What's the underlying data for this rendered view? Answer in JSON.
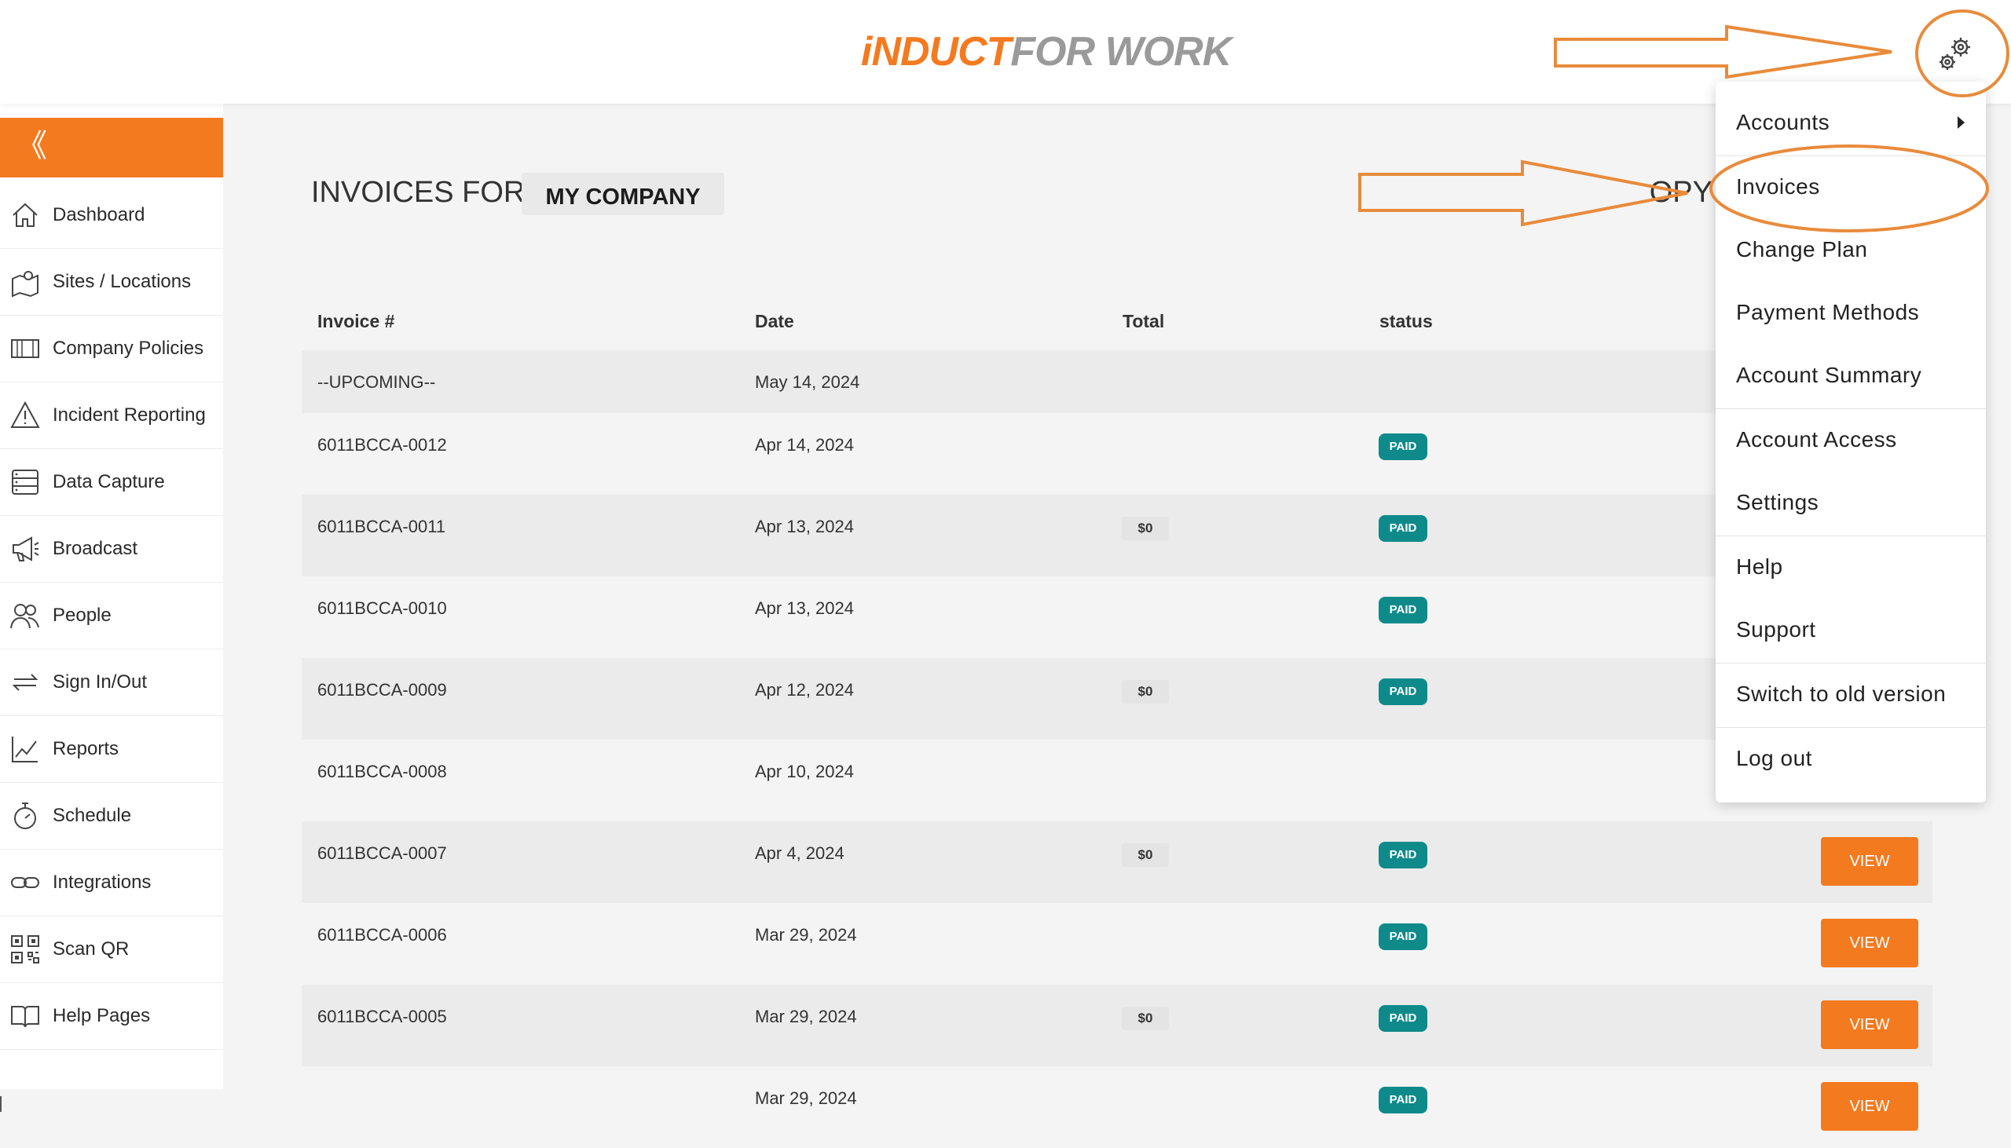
{
  "header": {
    "logo_part1": "iNDUCT",
    "logo_part2": "FOR WORK",
    "settings_icon": "gear-icon"
  },
  "sidebar": {
    "collapse_glyph": "《",
    "items": [
      {
        "label": "Dashboard",
        "icon": "home-icon"
      },
      {
        "label": "Sites / Locations",
        "icon": "map-pin-icon"
      },
      {
        "label": "Company Policies",
        "icon": "film-strip-icon"
      },
      {
        "label": "Incident Reporting",
        "icon": "warning-icon"
      },
      {
        "label": "Data Capture",
        "icon": "database-icon"
      },
      {
        "label": "Broadcast",
        "icon": "megaphone-icon"
      },
      {
        "label": "People",
        "icon": "people-icon"
      },
      {
        "label": "Sign In/Out",
        "icon": "swap-icon"
      },
      {
        "label": "Reports",
        "icon": "line-chart-icon"
      },
      {
        "label": "Schedule",
        "icon": "stopwatch-icon"
      },
      {
        "label": "Integrations",
        "icon": "link-icon"
      },
      {
        "label": "Scan QR",
        "icon": "qr-code-icon"
      },
      {
        "label": "Help Pages",
        "icon": "book-icon"
      }
    ]
  },
  "main": {
    "heading": "INVOICES FOR",
    "company": "MY COMPANY",
    "partial_button_text": "OPY",
    "columns": {
      "invoice": "Invoice #",
      "date": "Date",
      "total": "Total",
      "status": "status"
    },
    "rows": [
      {
        "invoice": "--UPCOMING--",
        "date": "May 14, 2024",
        "total": "",
        "status": "",
        "view": ""
      },
      {
        "invoice": "6011BCCA-0012",
        "date": "Apr 14, 2024",
        "total": "",
        "status": "PAID",
        "view": ""
      },
      {
        "invoice": "6011BCCA-0011",
        "date": "Apr 13, 2024",
        "total": "$0",
        "status": "PAID",
        "view": ""
      },
      {
        "invoice": "6011BCCA-0010",
        "date": "Apr 13, 2024",
        "total": "",
        "status": "PAID",
        "view": ""
      },
      {
        "invoice": "6011BCCA-0009",
        "date": "Apr 12, 2024",
        "total": "$0",
        "status": "PAID",
        "view": ""
      },
      {
        "invoice": "6011BCCA-0008",
        "date": "Apr 10, 2024",
        "total": "",
        "status": "",
        "view": ""
      },
      {
        "invoice": "6011BCCA-0007",
        "date": "Apr 4, 2024",
        "total": "$0",
        "status": "PAID",
        "view": "VIEW"
      },
      {
        "invoice": "6011BCCA-0006",
        "date": "Mar 29, 2024",
        "total": "",
        "status": "PAID",
        "view": "VIEW"
      },
      {
        "invoice": "6011BCCA-0005",
        "date": "Mar 29, 2024",
        "total": "$0",
        "status": "PAID",
        "view": "VIEW"
      },
      {
        "invoice": "",
        "date": "Mar 29, 2024",
        "total": "",
        "status": "PAID",
        "view": "VIEW"
      }
    ]
  },
  "menu": {
    "items": [
      "Accounts",
      "Invoices",
      "Change Plan",
      "Payment Methods",
      "Account Summary",
      "Account Access",
      "Settings",
      "Help",
      "Support",
      "Switch to old version",
      "Log out"
    ],
    "submenu_icon": "caret-right-icon"
  },
  "colors": {
    "accent": "#f47a20",
    "paid_badge": "#0f8a8a",
    "annotation": "#e88b3c"
  }
}
